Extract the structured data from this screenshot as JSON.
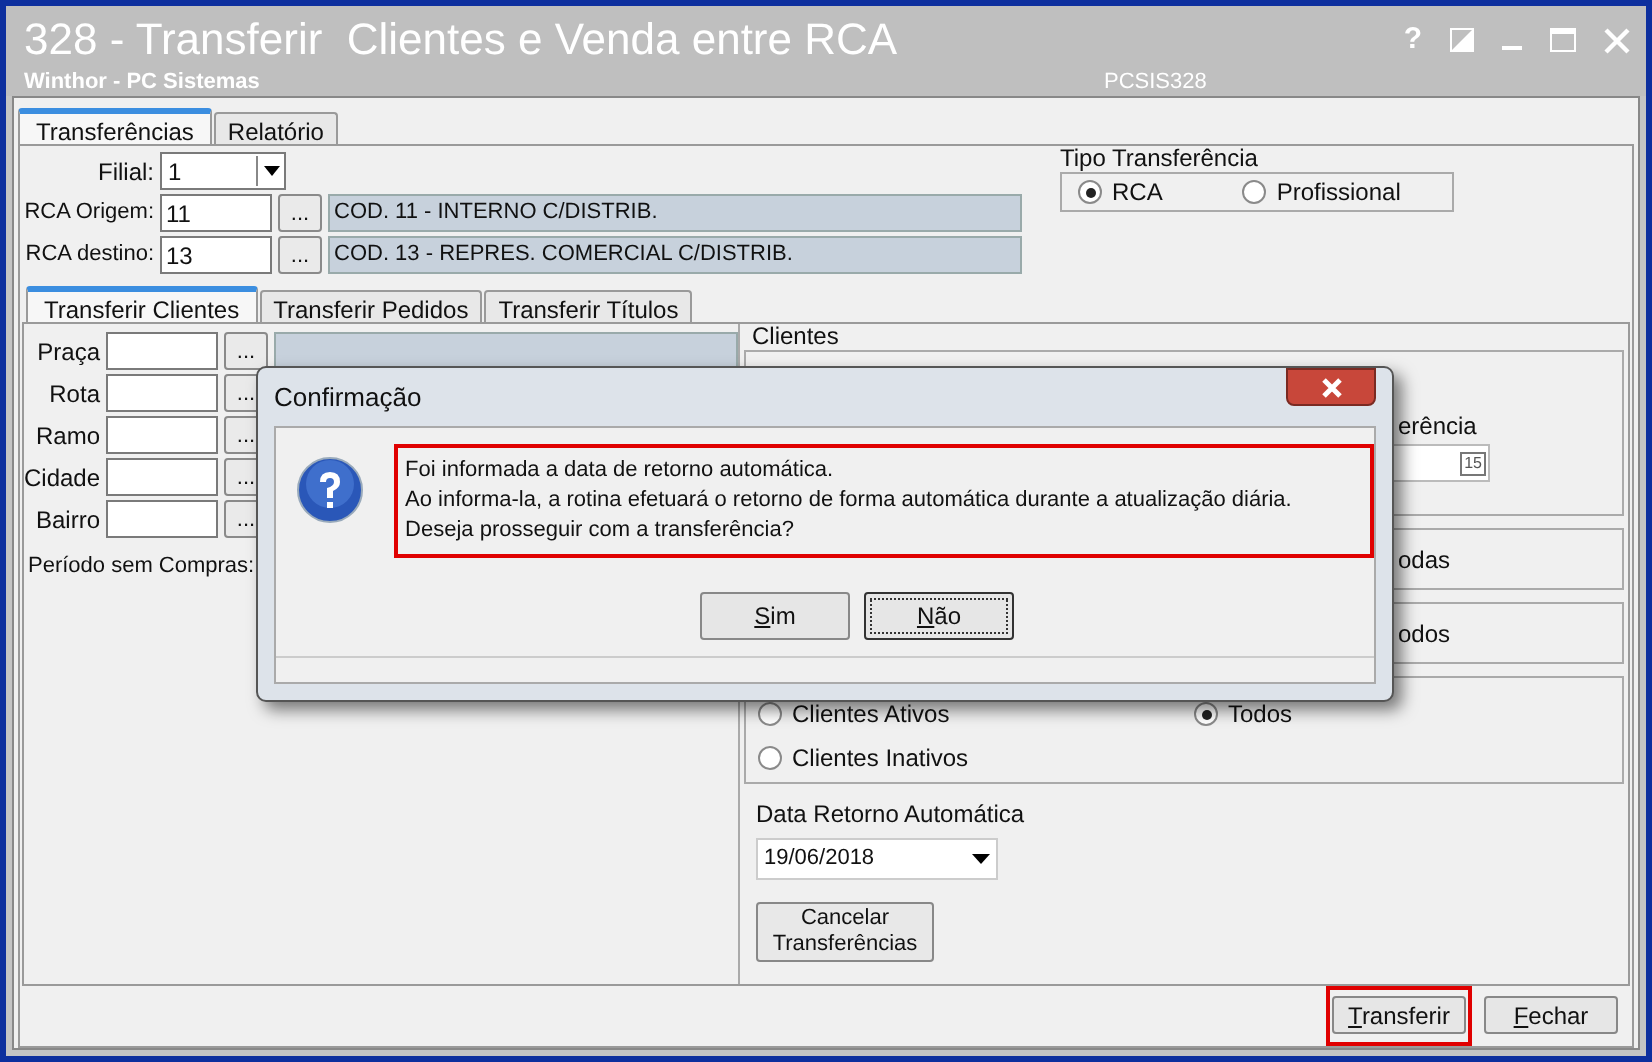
{
  "window": {
    "title": "328 - Transferir  Clientes e Venda entre RCA",
    "subtitle": "Winthor - PC Sistemas",
    "code": "PCSIS328",
    "help": "?"
  },
  "tabs": [
    {
      "label": "Transferências",
      "selected": true
    },
    {
      "label": "Relatório",
      "selected": false
    }
  ],
  "filial": {
    "label": "Filial:",
    "value": "1"
  },
  "rca_fields": [
    {
      "label": "RCA Origem:",
      "value": "11",
      "button": "...",
      "description": "COD. 11 - INTERNO C/DISTRIB."
    },
    {
      "label": "RCA destino:",
      "value": "13",
      "button": "...",
      "description": "COD. 13 - REPRES. COMERCIAL C/DISTRIB."
    }
  ],
  "tipo_transferencia": {
    "title": "Tipo Transferência",
    "options": [
      {
        "label": "RCA",
        "selected": true
      },
      {
        "label": "Profissional",
        "selected": false
      }
    ]
  },
  "sub_tabs": [
    {
      "label": "Transferir Clientes",
      "selected": true
    },
    {
      "label": "Transferir Pedidos",
      "selected": false
    },
    {
      "label": "Transferir Títulos",
      "selected": false
    }
  ],
  "filters": [
    {
      "label": "Praça",
      "button": "..."
    },
    {
      "label": "Rota",
      "button": "..."
    },
    {
      "label": "Ramo",
      "button": "..."
    },
    {
      "label": "Cidade",
      "button": "..."
    },
    {
      "label": "Bairro",
      "button": "..."
    }
  ],
  "period_label": "Período sem Compras:",
  "clientes_group": {
    "title": "Clientes",
    "date_label": "erência",
    "calendar_day": "15"
  },
  "hidden_groups": [
    {
      "text": "odas"
    },
    {
      "text": "odos"
    }
  ],
  "status_options": [
    {
      "label": "Clientes Ativos",
      "selected": false
    },
    {
      "label": "Todos",
      "selected": true
    },
    {
      "label": "Clientes Inativos",
      "selected": false
    }
  ],
  "retorno": {
    "label": "Data Retorno Automática",
    "value": "19/06/2018"
  },
  "cancel_button": "Cancelar Transferências",
  "footer_buttons": [
    {
      "label": "Transferir",
      "highlighted": true
    },
    {
      "label": "Fechar",
      "highlighted": false
    }
  ],
  "dialog": {
    "title": "Confirmação",
    "message": "Foi informada a data de retorno automática.\nAo informa-la, a rotina efetuará o retorno de forma automática durante a atualização diária.\nDeseja prosseguir com a transferência?",
    "highlighted": true,
    "buttons": [
      {
        "label": "Sim",
        "focused": false
      },
      {
        "label": "Não",
        "focused": true
      }
    ]
  }
}
